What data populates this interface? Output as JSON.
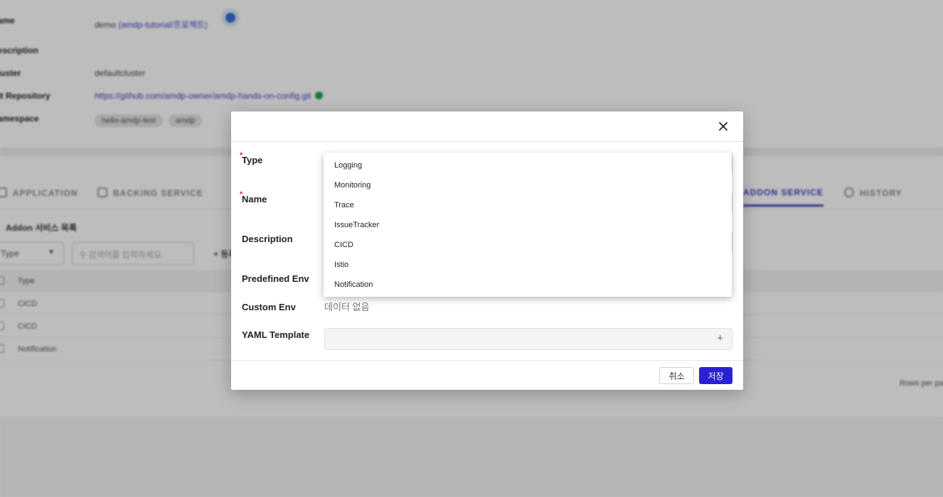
{
  "background": {
    "info": {
      "name_label": "Name",
      "name_value": "demo",
      "name_link": "(amdp-tutorial/프로젝트)",
      "description_label": "Description",
      "cluster_label": "Cluster",
      "cluster_value": "defaultcluster",
      "git_repository_label": "Git Repository",
      "git_repository_value": "https://github.com/amdp-owner/amdp-hands-on-config.git",
      "namespace_label": "Namespace",
      "namespace_chips": [
        "hello-amdp-test",
        "amdp"
      ]
    },
    "tabs": [
      "APPLICATION",
      "BACKING SERVICE",
      "ADDON SERVICE",
      "HISTORY"
    ],
    "subtitle": "Addon 서비스 목록",
    "filter_value": "Type",
    "search_placeholder": "검색어를 입력하세요",
    "add_label": "+ 등록",
    "table": {
      "header": "Type",
      "rows": [
        "CICD",
        "CICD",
        "Notification"
      ]
    },
    "rows_per_page": "Rows per page"
  },
  "modal": {
    "close_icon": "close-icon",
    "fields": {
      "type": "Type",
      "name": "Name",
      "description": "Description",
      "predefined_env": "Predefined Env",
      "custom_env": "Custom Env",
      "yaml_template": "YAML Template"
    },
    "required_mark": "*",
    "custom_env_empty": "데이터 없음",
    "yaml_add": "+",
    "cancel_label": "취소",
    "save_label": "저장"
  },
  "type_dropdown": {
    "options": [
      "Logging",
      "Monitoring",
      "Trace",
      "IssueTracker",
      "CICD",
      "Istio",
      "Notification"
    ]
  },
  "colors": {
    "accent": "#2a20d4",
    "required": "#d32f2f",
    "link": "#3b3fc4",
    "status_ok": "#22a34a"
  }
}
